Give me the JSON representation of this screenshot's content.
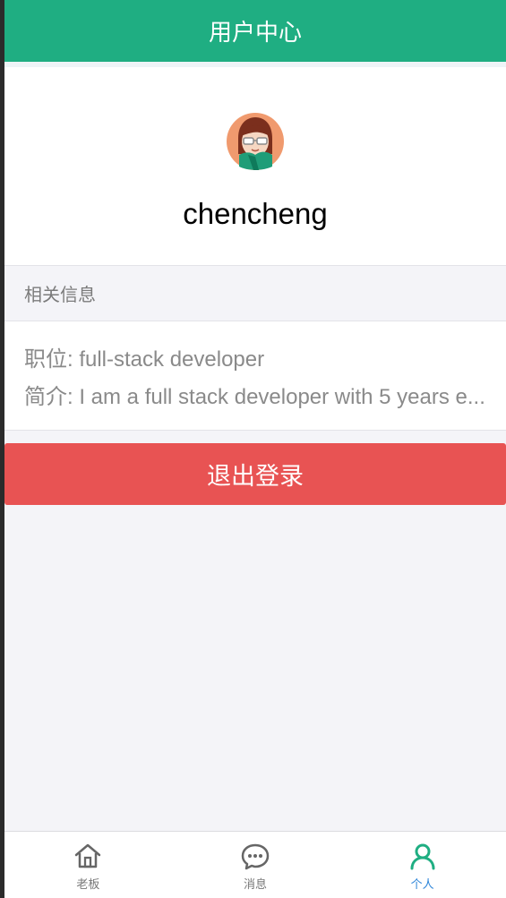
{
  "header": {
    "title": "用户中心"
  },
  "profile": {
    "username": "chencheng",
    "avatar_icon": "user-avatar"
  },
  "section": {
    "title": "相关信息"
  },
  "info": {
    "position": "职位: full-stack developer",
    "bio": "简介: I am a full stack developer with 5 years e..."
  },
  "actions": {
    "logout_label": "退出登录"
  },
  "tabs": [
    {
      "label": "老板",
      "icon": "home-icon",
      "active": false
    },
    {
      "label": "消息",
      "icon": "message-icon",
      "active": false
    },
    {
      "label": "个人",
      "icon": "person-icon",
      "active": true
    }
  ],
  "colors": {
    "primary": "#1fae82",
    "danger": "#e85353",
    "active_tab_text": "#2f86d9"
  }
}
